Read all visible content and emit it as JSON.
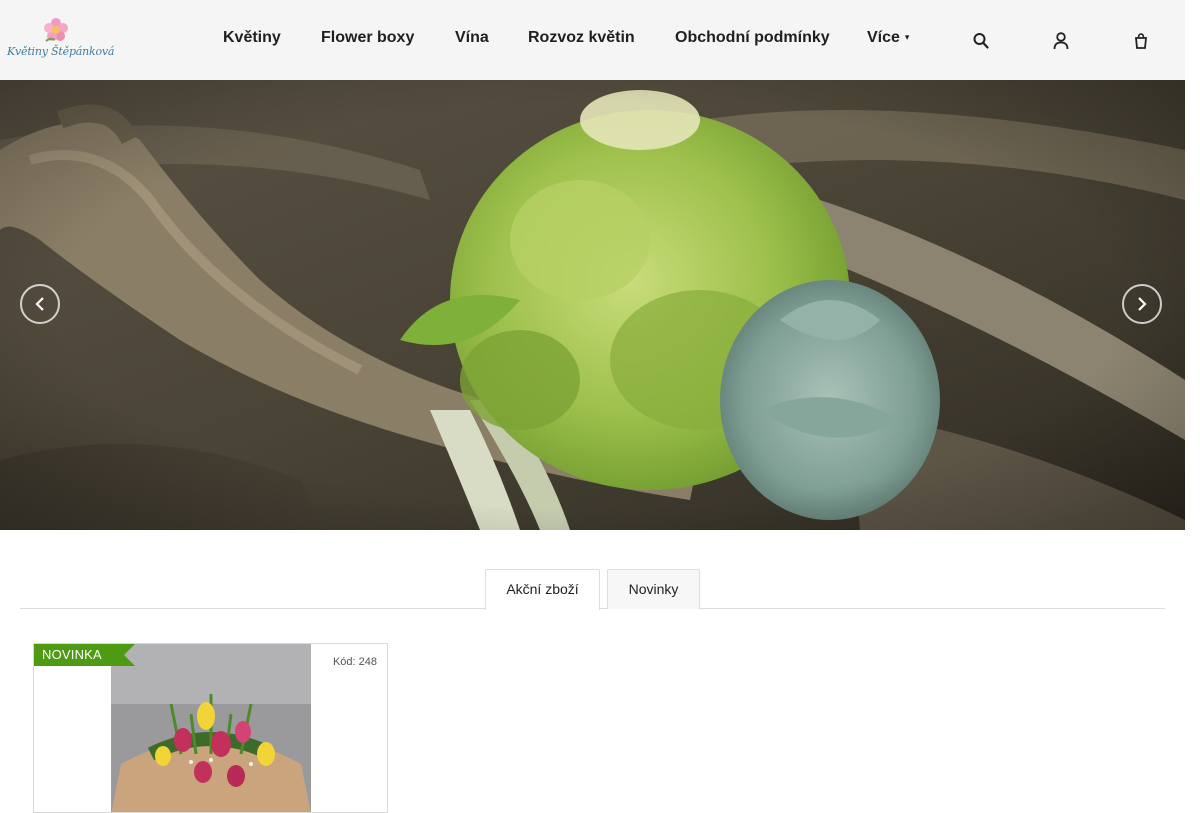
{
  "logo": {
    "text": "Květiny Štěpánková"
  },
  "nav": {
    "items": [
      "Květiny",
      "Flower boxy",
      "Vína",
      "Rozvoz květin",
      "Obchodní podmínky"
    ],
    "more_label": "Více"
  },
  "header_icons": [
    "search-icon",
    "user-icon",
    "cart-icon"
  ],
  "hero": {
    "prev_icon": "chevron-left-icon",
    "next_icon": "chevron-right-icon"
  },
  "tabs": [
    {
      "label": "Akční zboží",
      "active": true
    },
    {
      "label": "Novinky",
      "active": false
    }
  ],
  "product": {
    "badge": "NOVINKA",
    "code": "Kód: 248"
  },
  "colors": {
    "header_bg": "#f5f5f5",
    "badge_green": "#4e9a12",
    "logo_blue": "#3f7ea0"
  }
}
